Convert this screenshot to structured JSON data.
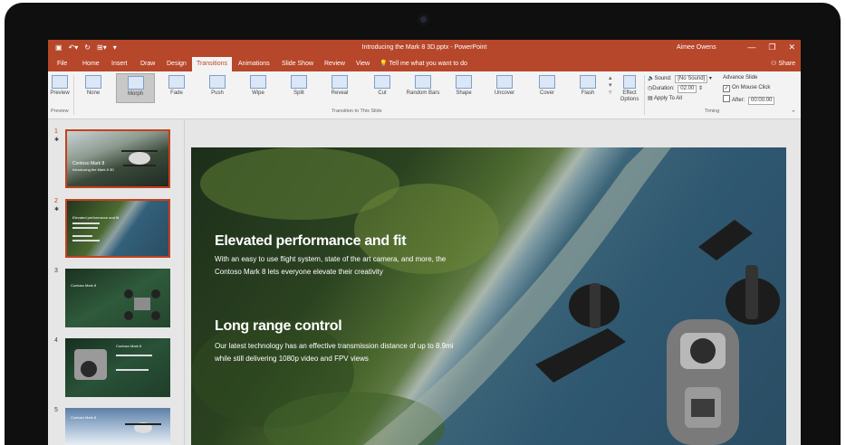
{
  "window": {
    "title": "Introducing the Mark 8 3D.pptx  -  PowerPoint",
    "user": "Aimee Owens",
    "qat": [
      "▣",
      "↶▾",
      "↻",
      "⊞▾",
      "▾"
    ],
    "controls": [
      "—",
      "❐",
      "✕"
    ]
  },
  "tabs": [
    "File",
    "Home",
    "Insert",
    "Draw",
    "Design",
    "Transitions",
    "Animations",
    "Slide Show",
    "Review",
    "View"
  ],
  "active_tab": "Transitions",
  "tell_me": "Tell me what you want to do",
  "share": "Share",
  "ribbon": {
    "preview_label": "Preview",
    "preview_group": "Preview",
    "transitions": [
      "None",
      "Morph",
      "Fade",
      "Push",
      "Wipe",
      "Split",
      "Reveal",
      "Cut",
      "Random Bars",
      "Shape",
      "Uncover",
      "Cover",
      "Flash"
    ],
    "selected_transition": "Morph",
    "effect_options": "Effect Options",
    "group_transitions": "Transition to This Slide",
    "sound_label": "Sound:",
    "sound_value": "[No Sound]",
    "duration_label": "Duration:",
    "duration_value": "02.00",
    "apply_all": "Apply To All",
    "advance_title": "Advance Slide",
    "on_mouse_click": "On Mouse Click",
    "after_label": "After:",
    "after_value": "00:00.00",
    "group_timing": "Timing"
  },
  "thumbnails": [
    {
      "number": "1",
      "title": "Contoso Mark 8",
      "subtitle": "Introducing the Mark 8 3D",
      "selected": true
    },
    {
      "number": "2",
      "title": "Elevated performance and fit",
      "subtitle": "",
      "selected": true
    },
    {
      "number": "3",
      "title": "Contoso Mark 8",
      "subtitle": "",
      "selected": false
    },
    {
      "number": "4",
      "title": "Contoso Mark 8",
      "subtitle": "",
      "selected": false
    },
    {
      "number": "5",
      "title": "Contoso Mark 8",
      "subtitle": "",
      "selected": false
    }
  ],
  "slide": {
    "heading1": "Elevated performance and fit",
    "body1": "With an easy to use flight system, state of the art camera, and more, the Contoso Mark 8 lets everyone elevate their creativity",
    "heading2": "Long range control",
    "body2": "Our latest technology has an effective transmission distance of up to 8.9mi while still delivering 1080p video and FPV views"
  },
  "colors": {
    "accent": "#b7472a",
    "selection": "#c5401e"
  }
}
